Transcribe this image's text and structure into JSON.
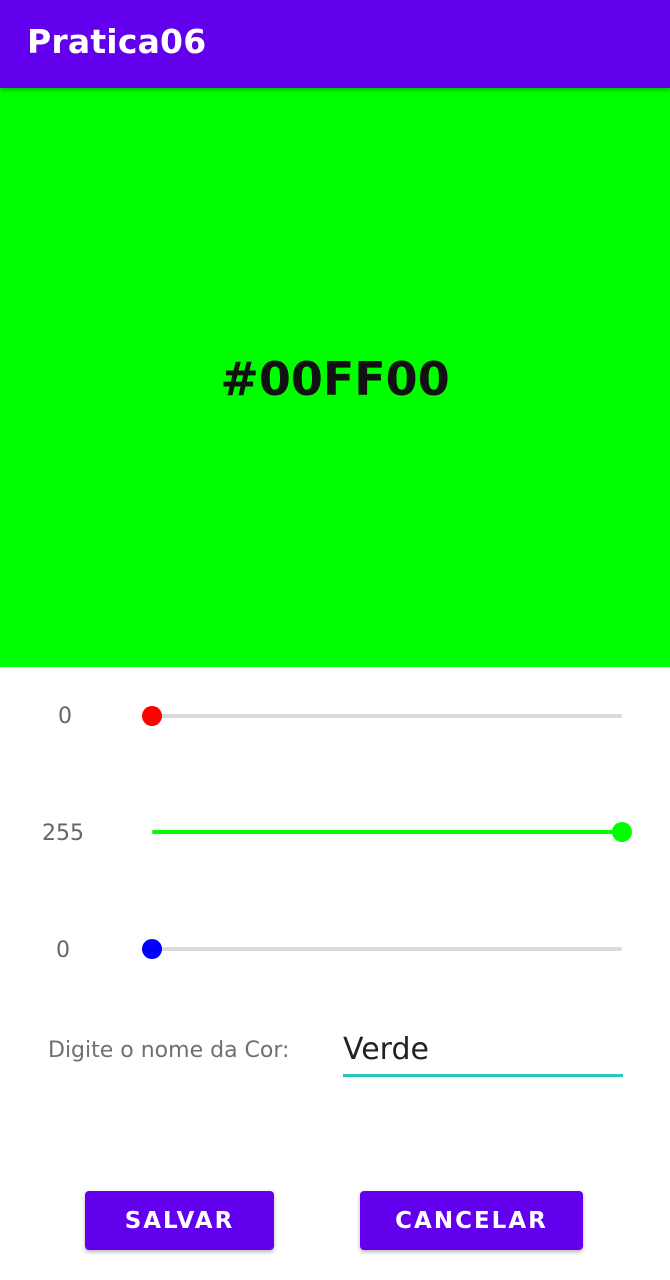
{
  "app": {
    "title": "Pratica06",
    "accent_color": "#6200EE"
  },
  "preview": {
    "color": "#00FF00",
    "hex_label": "#00FF00"
  },
  "sliders": [
    {
      "name": "red",
      "value": "0",
      "level": 0,
      "max": 255,
      "color": "#FF0000"
    },
    {
      "name": "green",
      "value": "255",
      "level": 255,
      "max": 255,
      "color": "#00FF00"
    },
    {
      "name": "blue",
      "value": "0",
      "level": 0,
      "max": 255,
      "color": "#0000FF"
    }
  ],
  "color_name": {
    "label": "Digite o nome da Cor:",
    "value": "Verde"
  },
  "buttons": {
    "save_label": "SALVAR",
    "cancel_label": "CANCELAR"
  }
}
